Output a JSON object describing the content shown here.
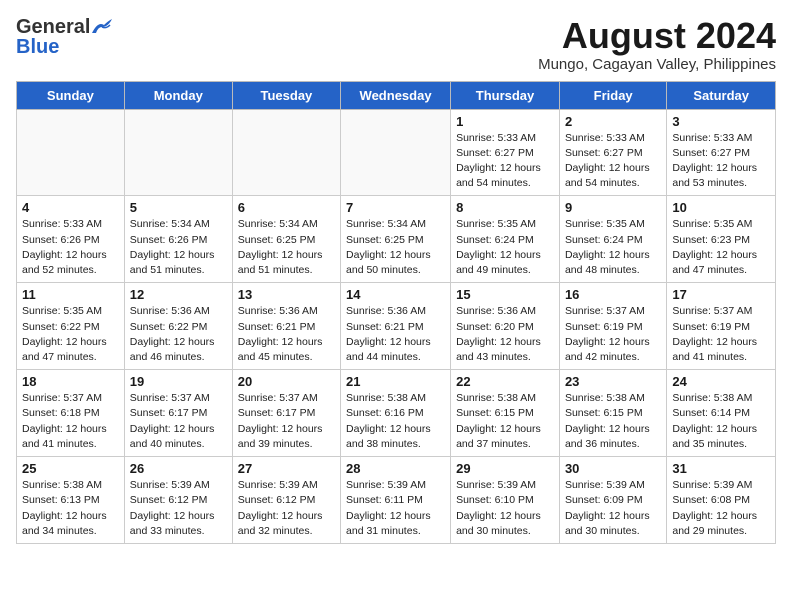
{
  "logo": {
    "line1": "General",
    "line2": "Blue"
  },
  "title": "August 2024",
  "location": "Mungo, Cagayan Valley, Philippines",
  "weekdays": [
    "Sunday",
    "Monday",
    "Tuesday",
    "Wednesday",
    "Thursday",
    "Friday",
    "Saturday"
  ],
  "weeks": [
    [
      {
        "day": "",
        "info": ""
      },
      {
        "day": "",
        "info": ""
      },
      {
        "day": "",
        "info": ""
      },
      {
        "day": "",
        "info": ""
      },
      {
        "day": "1",
        "info": "Sunrise: 5:33 AM\nSunset: 6:27 PM\nDaylight: 12 hours\nand 54 minutes."
      },
      {
        "day": "2",
        "info": "Sunrise: 5:33 AM\nSunset: 6:27 PM\nDaylight: 12 hours\nand 54 minutes."
      },
      {
        "day": "3",
        "info": "Sunrise: 5:33 AM\nSunset: 6:27 PM\nDaylight: 12 hours\nand 53 minutes."
      }
    ],
    [
      {
        "day": "4",
        "info": "Sunrise: 5:33 AM\nSunset: 6:26 PM\nDaylight: 12 hours\nand 52 minutes."
      },
      {
        "day": "5",
        "info": "Sunrise: 5:34 AM\nSunset: 6:26 PM\nDaylight: 12 hours\nand 51 minutes."
      },
      {
        "day": "6",
        "info": "Sunrise: 5:34 AM\nSunset: 6:25 PM\nDaylight: 12 hours\nand 51 minutes."
      },
      {
        "day": "7",
        "info": "Sunrise: 5:34 AM\nSunset: 6:25 PM\nDaylight: 12 hours\nand 50 minutes."
      },
      {
        "day": "8",
        "info": "Sunrise: 5:35 AM\nSunset: 6:24 PM\nDaylight: 12 hours\nand 49 minutes."
      },
      {
        "day": "9",
        "info": "Sunrise: 5:35 AM\nSunset: 6:24 PM\nDaylight: 12 hours\nand 48 minutes."
      },
      {
        "day": "10",
        "info": "Sunrise: 5:35 AM\nSunset: 6:23 PM\nDaylight: 12 hours\nand 47 minutes."
      }
    ],
    [
      {
        "day": "11",
        "info": "Sunrise: 5:35 AM\nSunset: 6:22 PM\nDaylight: 12 hours\nand 47 minutes."
      },
      {
        "day": "12",
        "info": "Sunrise: 5:36 AM\nSunset: 6:22 PM\nDaylight: 12 hours\nand 46 minutes."
      },
      {
        "day": "13",
        "info": "Sunrise: 5:36 AM\nSunset: 6:21 PM\nDaylight: 12 hours\nand 45 minutes."
      },
      {
        "day": "14",
        "info": "Sunrise: 5:36 AM\nSunset: 6:21 PM\nDaylight: 12 hours\nand 44 minutes."
      },
      {
        "day": "15",
        "info": "Sunrise: 5:36 AM\nSunset: 6:20 PM\nDaylight: 12 hours\nand 43 minutes."
      },
      {
        "day": "16",
        "info": "Sunrise: 5:37 AM\nSunset: 6:19 PM\nDaylight: 12 hours\nand 42 minutes."
      },
      {
        "day": "17",
        "info": "Sunrise: 5:37 AM\nSunset: 6:19 PM\nDaylight: 12 hours\nand 41 minutes."
      }
    ],
    [
      {
        "day": "18",
        "info": "Sunrise: 5:37 AM\nSunset: 6:18 PM\nDaylight: 12 hours\nand 41 minutes."
      },
      {
        "day": "19",
        "info": "Sunrise: 5:37 AM\nSunset: 6:17 PM\nDaylight: 12 hours\nand 40 minutes."
      },
      {
        "day": "20",
        "info": "Sunrise: 5:37 AM\nSunset: 6:17 PM\nDaylight: 12 hours\nand 39 minutes."
      },
      {
        "day": "21",
        "info": "Sunrise: 5:38 AM\nSunset: 6:16 PM\nDaylight: 12 hours\nand 38 minutes."
      },
      {
        "day": "22",
        "info": "Sunrise: 5:38 AM\nSunset: 6:15 PM\nDaylight: 12 hours\nand 37 minutes."
      },
      {
        "day": "23",
        "info": "Sunrise: 5:38 AM\nSunset: 6:15 PM\nDaylight: 12 hours\nand 36 minutes."
      },
      {
        "day": "24",
        "info": "Sunrise: 5:38 AM\nSunset: 6:14 PM\nDaylight: 12 hours\nand 35 minutes."
      }
    ],
    [
      {
        "day": "25",
        "info": "Sunrise: 5:38 AM\nSunset: 6:13 PM\nDaylight: 12 hours\nand 34 minutes."
      },
      {
        "day": "26",
        "info": "Sunrise: 5:39 AM\nSunset: 6:12 PM\nDaylight: 12 hours\nand 33 minutes."
      },
      {
        "day": "27",
        "info": "Sunrise: 5:39 AM\nSunset: 6:12 PM\nDaylight: 12 hours\nand 32 minutes."
      },
      {
        "day": "28",
        "info": "Sunrise: 5:39 AM\nSunset: 6:11 PM\nDaylight: 12 hours\nand 31 minutes."
      },
      {
        "day": "29",
        "info": "Sunrise: 5:39 AM\nSunset: 6:10 PM\nDaylight: 12 hours\nand 30 minutes."
      },
      {
        "day": "30",
        "info": "Sunrise: 5:39 AM\nSunset: 6:09 PM\nDaylight: 12 hours\nand 30 minutes."
      },
      {
        "day": "31",
        "info": "Sunrise: 5:39 AM\nSunset: 6:08 PM\nDaylight: 12 hours\nand 29 minutes."
      }
    ]
  ]
}
